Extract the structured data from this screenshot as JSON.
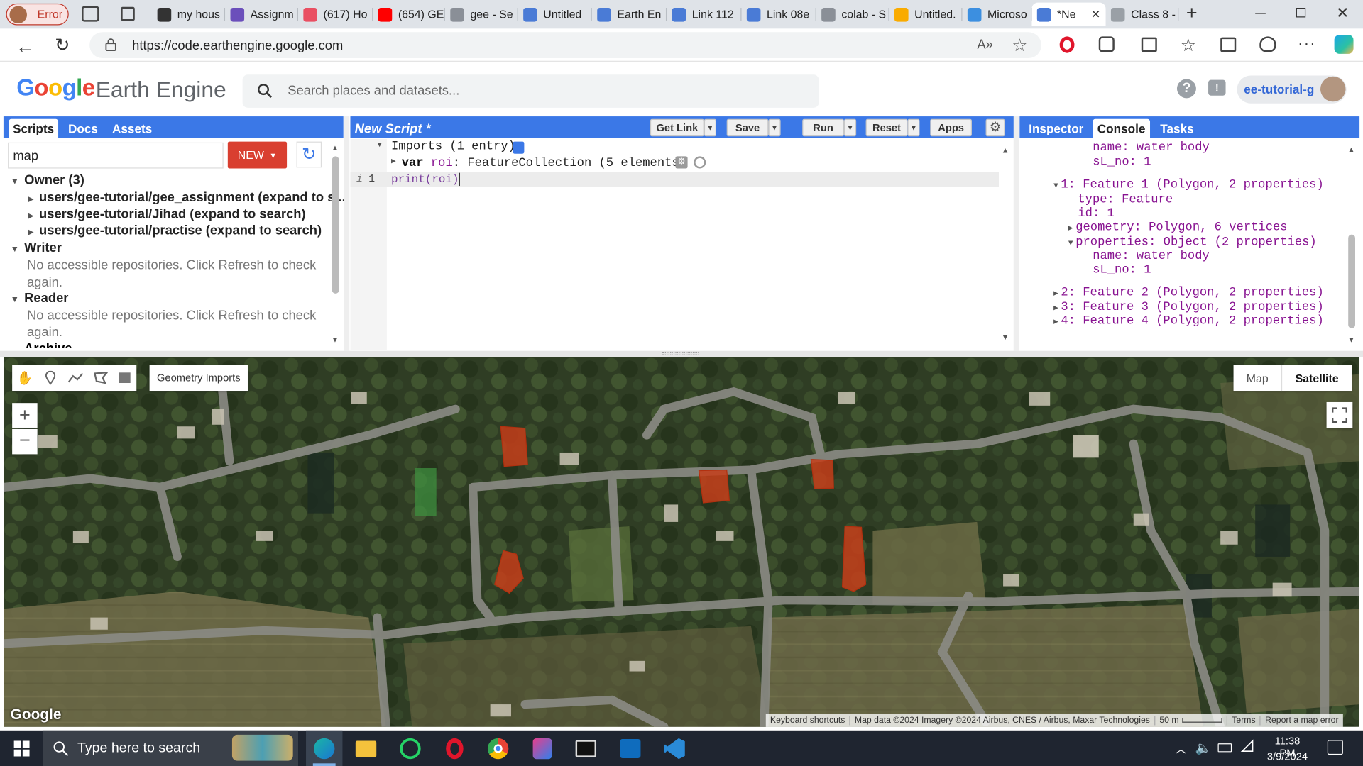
{
  "browser": {
    "profile_label": "Error",
    "tabs": [
      {
        "title": "my hous",
        "color": "#333"
      },
      {
        "title": "Assignm",
        "color": "#6b4fbb"
      },
      {
        "title": "(617) Ho",
        "color": "#e94f62"
      },
      {
        "title": "(654) GE",
        "color": "#ff0000"
      },
      {
        "title": "gee - Se",
        "color": "#8a8f97"
      },
      {
        "title": "Untitled",
        "color": "#4a7bd6"
      },
      {
        "title": "Earth En",
        "color": "#4a7bd6"
      },
      {
        "title": "Link 112",
        "color": "#4a7bd6"
      },
      {
        "title": "Link 08e",
        "color": "#4a7bd6"
      },
      {
        "title": "colab - S",
        "color": "#8a8f97"
      },
      {
        "title": "Untitled.",
        "color": "#f9ab00"
      },
      {
        "title": "Microso",
        "color": "#3c8fe0"
      },
      {
        "title": "*Ne",
        "color": "#4a7bd6"
      },
      {
        "title": "Class 8 -",
        "color": "#9aa0a6"
      }
    ],
    "url": "https://code.earthengine.google.com"
  },
  "gee": {
    "logo_google": "Google",
    "logo_product": "Earth Engine",
    "search_placeholder": "Search places and datasets...",
    "account": "ee-tutorial-g",
    "left_tabs": [
      "Scripts",
      "Docs",
      "Assets"
    ],
    "filter_value": "map",
    "new_button": "NEW",
    "tree": {
      "owner": "Owner (3)",
      "owner_items": [
        "users/gee-tutorial/gee_assignment (expand to s...",
        "users/gee-tutorial/Jihad (expand to search)",
        "users/gee-tutorial/practise (expand to search)"
      ],
      "writer": "Writer",
      "writer_msg_1": "No accessible repositories. Click Refresh to check",
      "writer_msg_2": "again.",
      "reader": "Reader",
      "reader_msg_1": "No accessible repositories. Click Refresh to check",
      "reader_msg_2": "again.",
      "archive": "Archive"
    },
    "editor": {
      "title": "New Script *",
      "buttons": {
        "get_link": "Get Link",
        "save": "Save",
        "run": "Run",
        "reset": "Reset",
        "apps": "Apps"
      },
      "imports_label": "Imports (1 entry)",
      "import_var": "var",
      "import_name": "roi",
      "import_value": ": FeatureCollection (5 elements)",
      "line_number": "1",
      "line_info": "i",
      "code_fn": "print",
      "code_open": "(",
      "code_arg": "roi",
      "code_close": ")"
    },
    "right_tabs": [
      "Inspector",
      "Console",
      "Tasks"
    ],
    "console": {
      "l1": "name: water body",
      "l2": "sL_no: 1",
      "f1": "1: Feature 1 (Polygon, 2 properties)",
      "f1_type": "type: Feature",
      "f1_id": "id: 1",
      "f1_geom": "geometry: Polygon, 6 vertices",
      "f1_props": "properties: Object (2 properties)",
      "f1_name": "name: water body",
      "f1_sl": "sL_no: 1",
      "f2": "2: Feature 2 (Polygon, 2 properties)",
      "f3": "3: Feature 3 (Polygon, 2 properties)",
      "f4": "4: Feature 4 (Polygon, 2 properties)"
    },
    "map": {
      "geometry_imports": "Geometry Imports",
      "zoom_in": "+",
      "zoom_out": "−",
      "map_type_map": "Map",
      "map_type_satellite": "Satellite",
      "google_watermark": "Google",
      "attribution": {
        "shortcuts": "Keyboard shortcuts",
        "data": "Map data ©2024 Imagery ©2024 Airbus, CNES / Airbus, Maxar Technologies",
        "scale": "50 m",
        "terms": "Terms",
        "report": "Report a map error"
      },
      "polygon_color": "#c63e1a"
    }
  },
  "taskbar": {
    "search_placeholder": "Type here to search",
    "time": "11:38 PM",
    "date": "3/9/2024"
  }
}
